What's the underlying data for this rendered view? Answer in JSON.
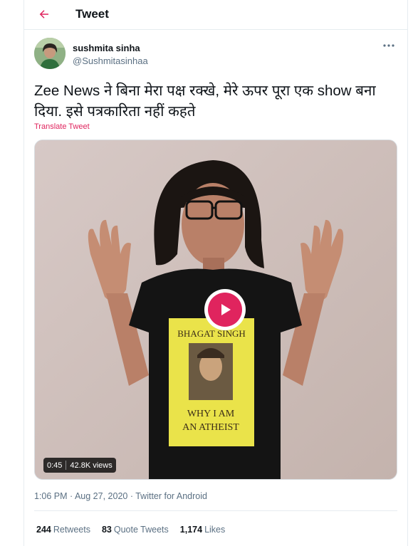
{
  "header": {
    "title": "Tweet",
    "back_icon": "back-arrow-icon"
  },
  "user": {
    "name": "sushmita sinha",
    "handle": "@Sushmitasinhaa"
  },
  "tweet": {
    "text": "Zee News ने बिना मेरा पक्ष रक्खे, मेरे ऊपर पूरा एक show बना दिया. इसे पत्रकारिता नहीं कहते",
    "translate_label": "Translate Tweet"
  },
  "video": {
    "duration": "0:45",
    "views": "42.8K views",
    "shirt_top_text": "BHAGAT SINGH",
    "shirt_bottom_line1": "WHY I AM",
    "shirt_bottom_line2": "AN ATHEIST"
  },
  "meta": {
    "timestamp": "1:06 PM · Aug 27, 2020 · Twitter for Android"
  },
  "stats": [
    {
      "count": "244",
      "label": "Retweets"
    },
    {
      "count": "83",
      "label": "Quote Tweets"
    },
    {
      "count": "1,174",
      "label": "Likes"
    }
  ],
  "colors": {
    "accent": "#e0245e",
    "secondary_text": "#5b7083",
    "border": "#e6ecf0"
  }
}
